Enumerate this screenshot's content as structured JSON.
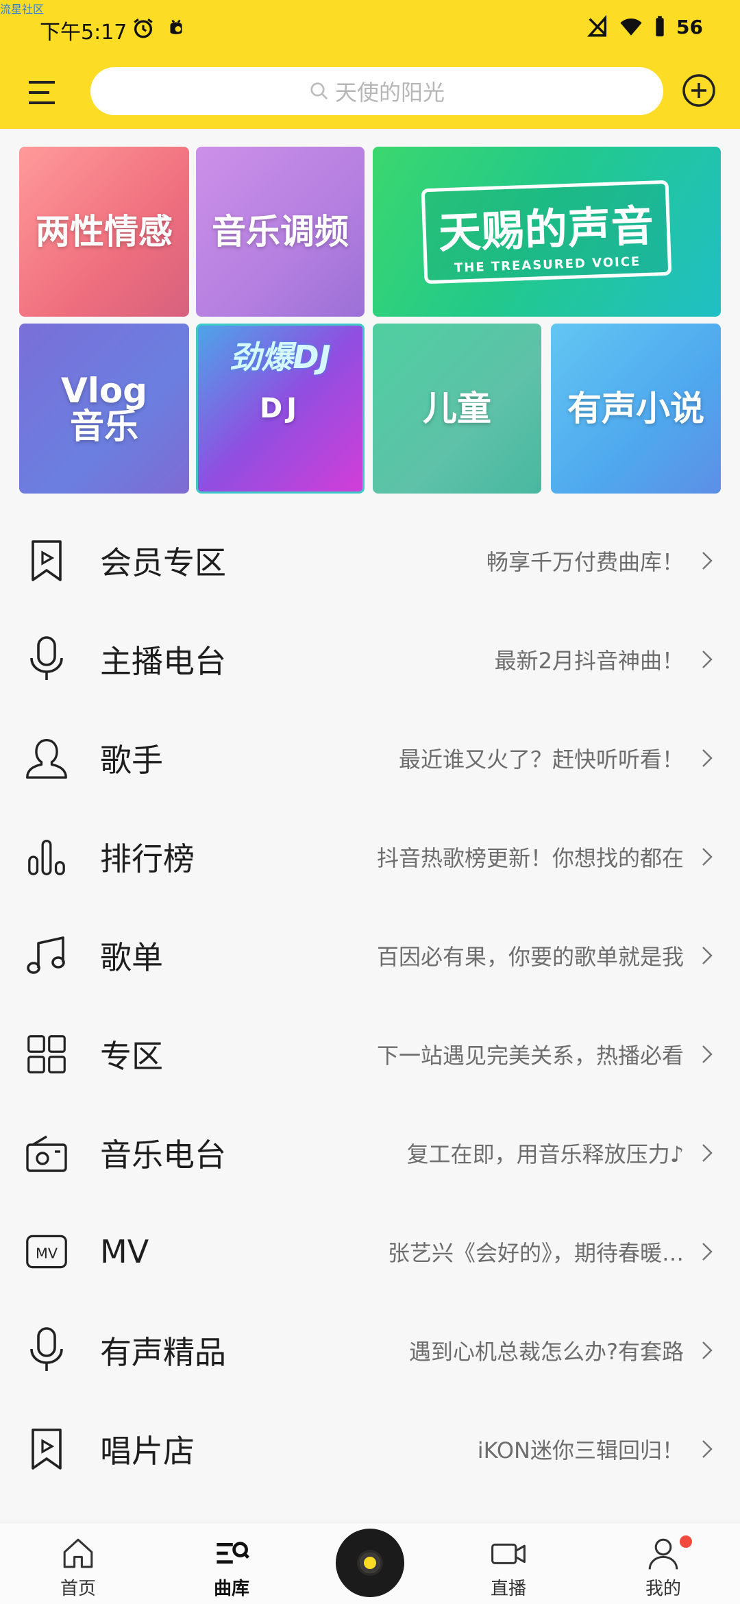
{
  "watermark": "流星社区",
  "status_bar": {
    "time": "下午5:17",
    "battery": "56",
    "icons": [
      "alarm-icon",
      "app-notification-icon",
      "no-sim-icon",
      "wifi-icon",
      "battery-icon"
    ]
  },
  "header": {
    "search_placeholder": "天使的阳光",
    "icons": [
      "menu-icon",
      "search-icon",
      "add-circle-icon"
    ],
    "accent_color": "#fcdc25"
  },
  "banners": [
    {
      "id": "t1",
      "label": "两性情感"
    },
    {
      "id": "t2",
      "label": "音乐调频"
    },
    {
      "id": "t3",
      "label": "天赐的声音",
      "sub": "THE TREASURED VOICE"
    },
    {
      "id": "t4",
      "label": "Vlog\n音乐"
    },
    {
      "id": "t5",
      "label": "DJ",
      "top_text": "劲爆DJ"
    },
    {
      "id": "t6",
      "label": "儿童"
    },
    {
      "id": "t7",
      "label": "有声小说"
    }
  ],
  "list": [
    {
      "title": "会员专区",
      "subtitle": "畅享千万付费曲库！",
      "icon": "bookmark-play-icon"
    },
    {
      "title": "主播电台",
      "subtitle": "最新2月抖音神曲！",
      "icon": "microphone-icon"
    },
    {
      "title": "歌手",
      "subtitle": "最近谁又火了？赶快听听看！",
      "icon": "singer-icon"
    },
    {
      "title": "排行榜",
      "subtitle": "抖音热歌榜更新！你想找的都在",
      "icon": "chart-bars-icon"
    },
    {
      "title": "歌单",
      "subtitle": "百因必有果，你要的歌单就是我",
      "icon": "music-note-icon"
    },
    {
      "title": "专区",
      "subtitle": "下一站遇见完美关系，热播必看",
      "icon": "grid-icon"
    },
    {
      "title": "音乐电台",
      "subtitle": "复工在即，用音乐释放压力♪",
      "icon": "radio-icon"
    },
    {
      "title": "MV",
      "subtitle": "张艺兴《会好的》，期待春暖…",
      "icon": "mv-icon"
    },
    {
      "title": "有声精品",
      "subtitle": "遇到心机总裁怎么办?有套路",
      "icon": "microphone-icon"
    },
    {
      "title": "唱片店",
      "subtitle": "iKON迷你三辑回归！",
      "icon": "bookmark-play-icon"
    }
  ],
  "bottom_nav": {
    "home": "首页",
    "library": "曲库",
    "live": "直播",
    "me": "我的",
    "active": "library"
  }
}
